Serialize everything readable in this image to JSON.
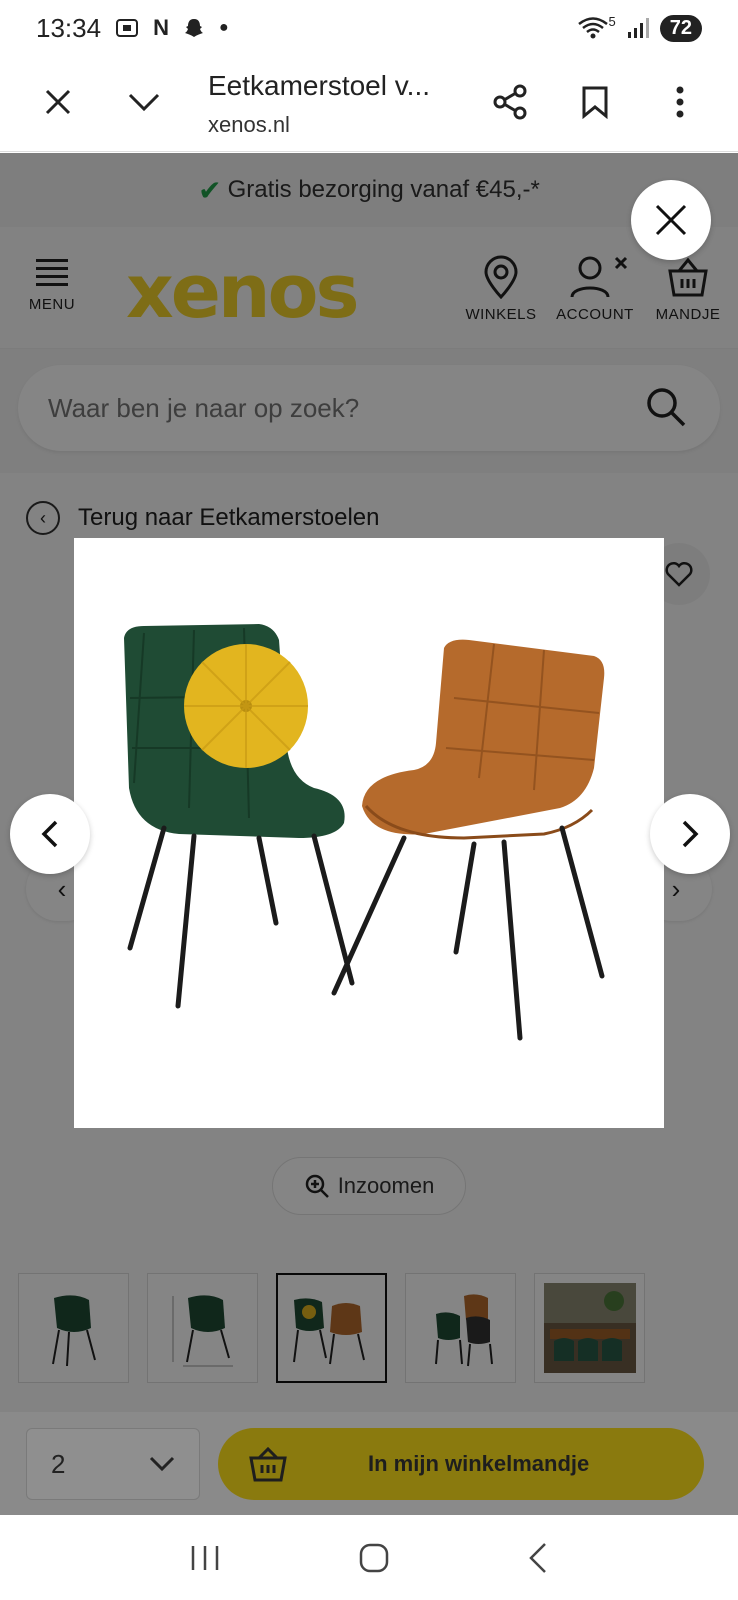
{
  "status_bar": {
    "time": "13:34",
    "notif_icons": [
      "N"
    ],
    "wifi_badge": "5",
    "battery": "72"
  },
  "browser": {
    "title": "Eetkamerstoel v...",
    "url": "xenos.nl"
  },
  "promo": {
    "text": "Gratis bezorging vanaf €45,-*"
  },
  "header": {
    "menu_label": "MENU",
    "logo": "xenos",
    "stores_label": "WINKELS",
    "account_label": "ACCOUNT",
    "cart_label": "MANDJE"
  },
  "search": {
    "placeholder": "Waar ben je naar op zoek?"
  },
  "breadcrumb": {
    "back_label": "Terug naar Eetkamerstoelen"
  },
  "gallery": {
    "zoom_label": "Inzoomen"
  },
  "buy_bar": {
    "quantity": "2",
    "add_to_cart_label": "In mijn winkelmandje"
  },
  "colors": {
    "brand_yellow": "#f2d22b",
    "check_green": "#21a04a",
    "green_velvet": "#1f4b34",
    "cognac_velvet": "#b56a2c",
    "mustard_cushion": "#e2b51f"
  }
}
